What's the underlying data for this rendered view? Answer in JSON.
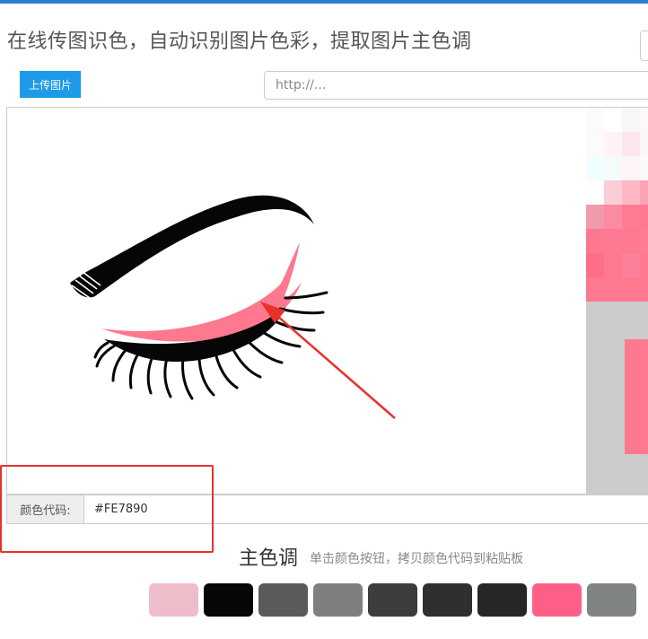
{
  "header": {
    "title": "在线传图识色，自动识别图片色彩，提取图片主色调"
  },
  "toolbar": {
    "upload_label": "上传图片",
    "url_placeholder": "http://..."
  },
  "colors": {
    "accent_blue": "#2a7fd4",
    "upload_button": "#1e9be8",
    "eyeliner_pink": "#FE7890",
    "highlight_red": "#e8312c"
  },
  "color_code": {
    "label": "颜色代码:",
    "value": "#FE7890"
  },
  "palette": {
    "title": "主色调",
    "hint": "单击颜色按钮，拷贝颜色代码到粘贴板",
    "swatches": [
      "#efbcc9",
      "#060606",
      "#5a5a5a",
      "#7f7f7f",
      "#3c3c3c",
      "#2f2f2f",
      "#262626",
      "#fe5f87",
      "#7f8482"
    ]
  },
  "pixel_preview": {
    "rows": [
      [
        "#fbfbfb",
        "#ffffff",
        "#f8f6f8",
        "#fcf8fa"
      ],
      [
        "#fdfafb",
        "#fff3f6",
        "#fde6ec",
        "#fcf6f9"
      ],
      [
        "#effefe",
        "#f3fbfb",
        "#fcf4f7",
        "#fbf9fa"
      ],
      [
        "#fefefe",
        "#fbcdd7",
        "#fdb7c5",
        "#fca3b5"
      ],
      [
        "#f19aac",
        "#fb8ba0",
        "#fd7c94",
        "#fd7890"
      ],
      [
        "#fc7890",
        "#fd7a92",
        "#fe7890",
        "#fd7d94"
      ],
      [
        "#fe6d89",
        "#fe7890",
        "#fc8099",
        "#fe7890"
      ],
      [
        "#fe7890",
        "#fd7890",
        "#fe7890",
        "#fe7890"
      ]
    ],
    "gray": "#cccccc",
    "block": "#fe7890"
  }
}
